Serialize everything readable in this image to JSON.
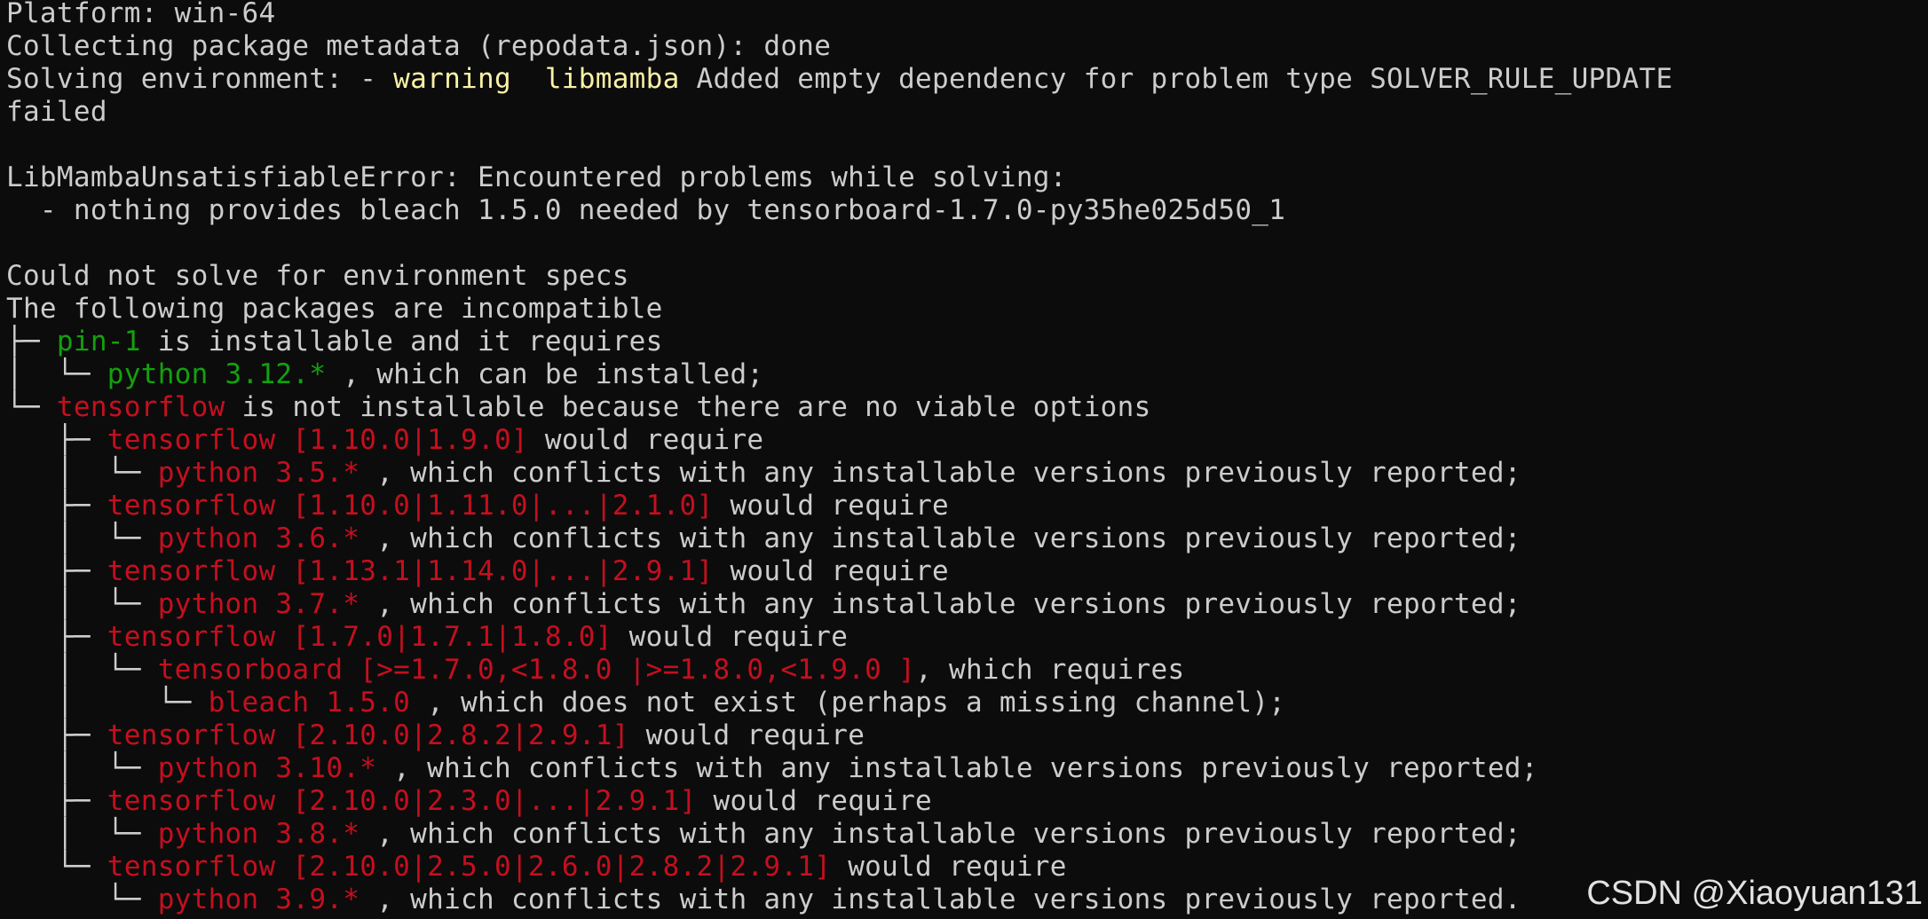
{
  "palette": {
    "background": "#0c0c0c",
    "default_text": "#cccccc",
    "warning": "#f9f1a5",
    "satisfied": "#13a10e",
    "unsatisfied": "#c50f1f"
  },
  "terminal": {
    "lines": [
      [
        {
          "c": "default",
          "t": "Platform: win-64"
        }
      ],
      [
        {
          "c": "default",
          "t": "Collecting package metadata (repodata.json): done"
        }
      ],
      [
        {
          "c": "default",
          "t": "Solving environment: - "
        },
        {
          "c": "yellow",
          "t": "warning  libmamba"
        },
        {
          "c": "default",
          "t": " Added empty dependency for problem type SOLVER_RULE_UPDATE"
        }
      ],
      [
        {
          "c": "default",
          "t": "failed"
        }
      ],
      [
        {
          "c": "default",
          "t": ""
        }
      ],
      [
        {
          "c": "default",
          "t": "LibMambaUnsatisfiableError: Encountered problems while solving:"
        }
      ],
      [
        {
          "c": "default",
          "t": "  - nothing provides bleach 1.5.0 needed by tensorboard-1.7.0-py35he025d50_1"
        }
      ],
      [
        {
          "c": "default",
          "t": ""
        }
      ],
      [
        {
          "c": "default",
          "t": "Could not solve for environment specs"
        }
      ],
      [
        {
          "c": "default",
          "t": "The following packages are incompatible"
        }
      ],
      [
        {
          "c": "default",
          "t": "├─ "
        },
        {
          "c": "green",
          "t": "pin-1"
        },
        {
          "c": "default",
          "t": " is installable and it requires"
        }
      ],
      [
        {
          "c": "default",
          "t": "│  └─ "
        },
        {
          "c": "green",
          "t": "python 3.12.*"
        },
        {
          "c": "default",
          "t": " , which can be installed;"
        }
      ],
      [
        {
          "c": "default",
          "t": "└─ "
        },
        {
          "c": "red",
          "t": "tensorflow"
        },
        {
          "c": "default",
          "t": " is not installable because there are no viable options"
        }
      ],
      [
        {
          "c": "default",
          "t": "   ├─ "
        },
        {
          "c": "red",
          "t": "tensorflow [1.10.0|1.9.0]"
        },
        {
          "c": "default",
          "t": " would require"
        }
      ],
      [
        {
          "c": "default",
          "t": "   │  └─ "
        },
        {
          "c": "red",
          "t": "python 3.5.*"
        },
        {
          "c": "default",
          "t": " , which conflicts with any installable versions previously reported;"
        }
      ],
      [
        {
          "c": "default",
          "t": "   ├─ "
        },
        {
          "c": "red",
          "t": "tensorflow [1.10.0|1.11.0|...|2.1.0]"
        },
        {
          "c": "default",
          "t": " would require"
        }
      ],
      [
        {
          "c": "default",
          "t": "   │  └─ "
        },
        {
          "c": "red",
          "t": "python 3.6.*"
        },
        {
          "c": "default",
          "t": " , which conflicts with any installable versions previously reported;"
        }
      ],
      [
        {
          "c": "default",
          "t": "   ├─ "
        },
        {
          "c": "red",
          "t": "tensorflow [1.13.1|1.14.0|...|2.9.1]"
        },
        {
          "c": "default",
          "t": " would require"
        }
      ],
      [
        {
          "c": "default",
          "t": "   │  └─ "
        },
        {
          "c": "red",
          "t": "python 3.7.*"
        },
        {
          "c": "default",
          "t": " , which conflicts with any installable versions previously reported;"
        }
      ],
      [
        {
          "c": "default",
          "t": "   ├─ "
        },
        {
          "c": "red",
          "t": "tensorflow [1.7.0|1.7.1|1.8.0]"
        },
        {
          "c": "default",
          "t": " would require"
        }
      ],
      [
        {
          "c": "default",
          "t": "   │  └─ "
        },
        {
          "c": "red",
          "t": "tensorboard [>=1.7.0,<1.8.0 |>=1.8.0,<1.9.0 ]"
        },
        {
          "c": "default",
          "t": ", which requires"
        }
      ],
      [
        {
          "c": "default",
          "t": "   │     └─ "
        },
        {
          "c": "red",
          "t": "bleach 1.5.0"
        },
        {
          "c": "default",
          "t": " , which does not exist (perhaps a missing channel);"
        }
      ],
      [
        {
          "c": "default",
          "t": "   ├─ "
        },
        {
          "c": "red",
          "t": "tensorflow [2.10.0|2.8.2|2.9.1]"
        },
        {
          "c": "default",
          "t": " would require"
        }
      ],
      [
        {
          "c": "default",
          "t": "   │  └─ "
        },
        {
          "c": "red",
          "t": "python 3.10.*"
        },
        {
          "c": "default",
          "t": " , which conflicts with any installable versions previously reported;"
        }
      ],
      [
        {
          "c": "default",
          "t": "   ├─ "
        },
        {
          "c": "red",
          "t": "tensorflow [2.10.0|2.3.0|...|2.9.1]"
        },
        {
          "c": "default",
          "t": " would require"
        }
      ],
      [
        {
          "c": "default",
          "t": "   │  └─ "
        },
        {
          "c": "red",
          "t": "python 3.8.*"
        },
        {
          "c": "default",
          "t": " , which conflicts with any installable versions previously reported;"
        }
      ],
      [
        {
          "c": "default",
          "t": "   └─ "
        },
        {
          "c": "red",
          "t": "tensorflow [2.10.0|2.5.0|2.6.0|2.8.2|2.9.1]"
        },
        {
          "c": "default",
          "t": " would require"
        }
      ],
      [
        {
          "c": "default",
          "t": "      └─ "
        },
        {
          "c": "red",
          "t": "python 3.9.*"
        },
        {
          "c": "default",
          "t": " , which conflicts with any installable versions previously reported."
        }
      ]
    ]
  },
  "watermark": {
    "text": "CSDN @Xiaoyuan131"
  }
}
